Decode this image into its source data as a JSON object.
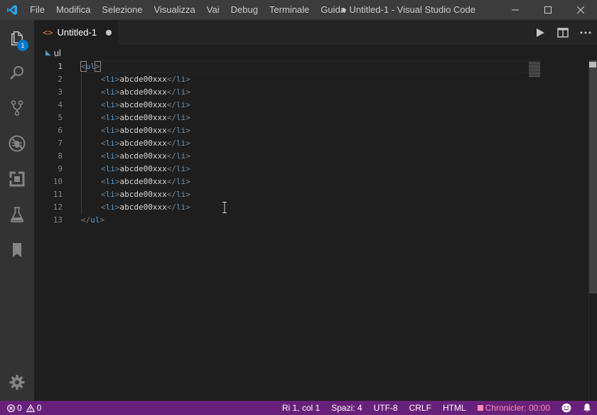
{
  "titlebar": {
    "menu": [
      "File",
      "Modifica",
      "Selezione",
      "Visualizza",
      "Vai",
      "Debug",
      "Terminale",
      "Guida"
    ],
    "title": "● Untitled-1 - Visual Studio Code"
  },
  "activitybar": {
    "explorer_badge": "1",
    "icons": [
      "files-icon",
      "search-icon",
      "source-control-icon",
      "debug-icon",
      "extensions-icon",
      "test-flask-icon",
      "bookmark-icon",
      "settings-gear-icon"
    ]
  },
  "tab": {
    "icon": "<>",
    "label": "Untitled-1"
  },
  "breadcrumb": {
    "label": "ul"
  },
  "editor": {
    "lines": [
      {
        "num": "1",
        "open": "<",
        "tag": "ul",
        "close": ">",
        "text": "",
        "indent": false
      },
      {
        "num": "2",
        "open": "<",
        "tag": "li",
        "close": ">",
        "text": "abcde00xxx",
        "end": "</",
        "endtag": "li",
        "endclose": ">",
        "indent": true
      },
      {
        "num": "3",
        "open": "<",
        "tag": "li",
        "close": ">",
        "text": "abcde00xxx",
        "end": "</",
        "endtag": "li",
        "endclose": ">",
        "indent": true
      },
      {
        "num": "4",
        "open": "<",
        "tag": "li",
        "close": ">",
        "text": "abcde00xxx",
        "end": "</",
        "endtag": "li",
        "endclose": ">",
        "indent": true
      },
      {
        "num": "5",
        "open": "<",
        "tag": "li",
        "close": ">",
        "text": "abcde00xxx",
        "end": "</",
        "endtag": "li",
        "endclose": ">",
        "indent": true
      },
      {
        "num": "6",
        "open": "<",
        "tag": "li",
        "close": ">",
        "text": "abcde00xxx",
        "end": "</",
        "endtag": "li",
        "endclose": ">",
        "indent": true
      },
      {
        "num": "7",
        "open": "<",
        "tag": "li",
        "close": ">",
        "text": "abcde00xxx",
        "end": "</",
        "endtag": "li",
        "endclose": ">",
        "indent": true
      },
      {
        "num": "8",
        "open": "<",
        "tag": "li",
        "close": ">",
        "text": "abcde00xxx",
        "end": "</",
        "endtag": "li",
        "endclose": ">",
        "indent": true
      },
      {
        "num": "9",
        "open": "<",
        "tag": "li",
        "close": ">",
        "text": "abcde00xxx",
        "end": "</",
        "endtag": "li",
        "endclose": ">",
        "indent": true
      },
      {
        "num": "10",
        "open": "<",
        "tag": "li",
        "close": ">",
        "text": "abcde00xxx",
        "end": "</",
        "endtag": "li",
        "endclose": ">",
        "indent": true
      },
      {
        "num": "11",
        "open": "<",
        "tag": "li",
        "close": ">",
        "text": "abcde00xxx",
        "end": "</",
        "endtag": "li",
        "endclose": ">",
        "indent": true
      },
      {
        "num": "12",
        "open": "<",
        "tag": "li",
        "close": ">",
        "text": "abcde00xxx",
        "end": "</",
        "endtag": "li",
        "endclose": ">",
        "indent": true
      },
      {
        "num": "13",
        "open": "</",
        "tag": "ul",
        "close": ">",
        "text": "",
        "indent": false
      }
    ]
  },
  "statusbar": {
    "errors": "0",
    "warnings": "0",
    "position": "Ri 1, col 1",
    "spaces": "Spazi: 4",
    "encoding": "UTF-8",
    "eol": "CRLF",
    "language": "HTML",
    "chronicler": "Chronicler: 00:00"
  },
  "colors": {
    "statusbar": "#68217a",
    "accent": "#007acc",
    "tag": "#569cd6",
    "tab_icon": "#e37933"
  }
}
